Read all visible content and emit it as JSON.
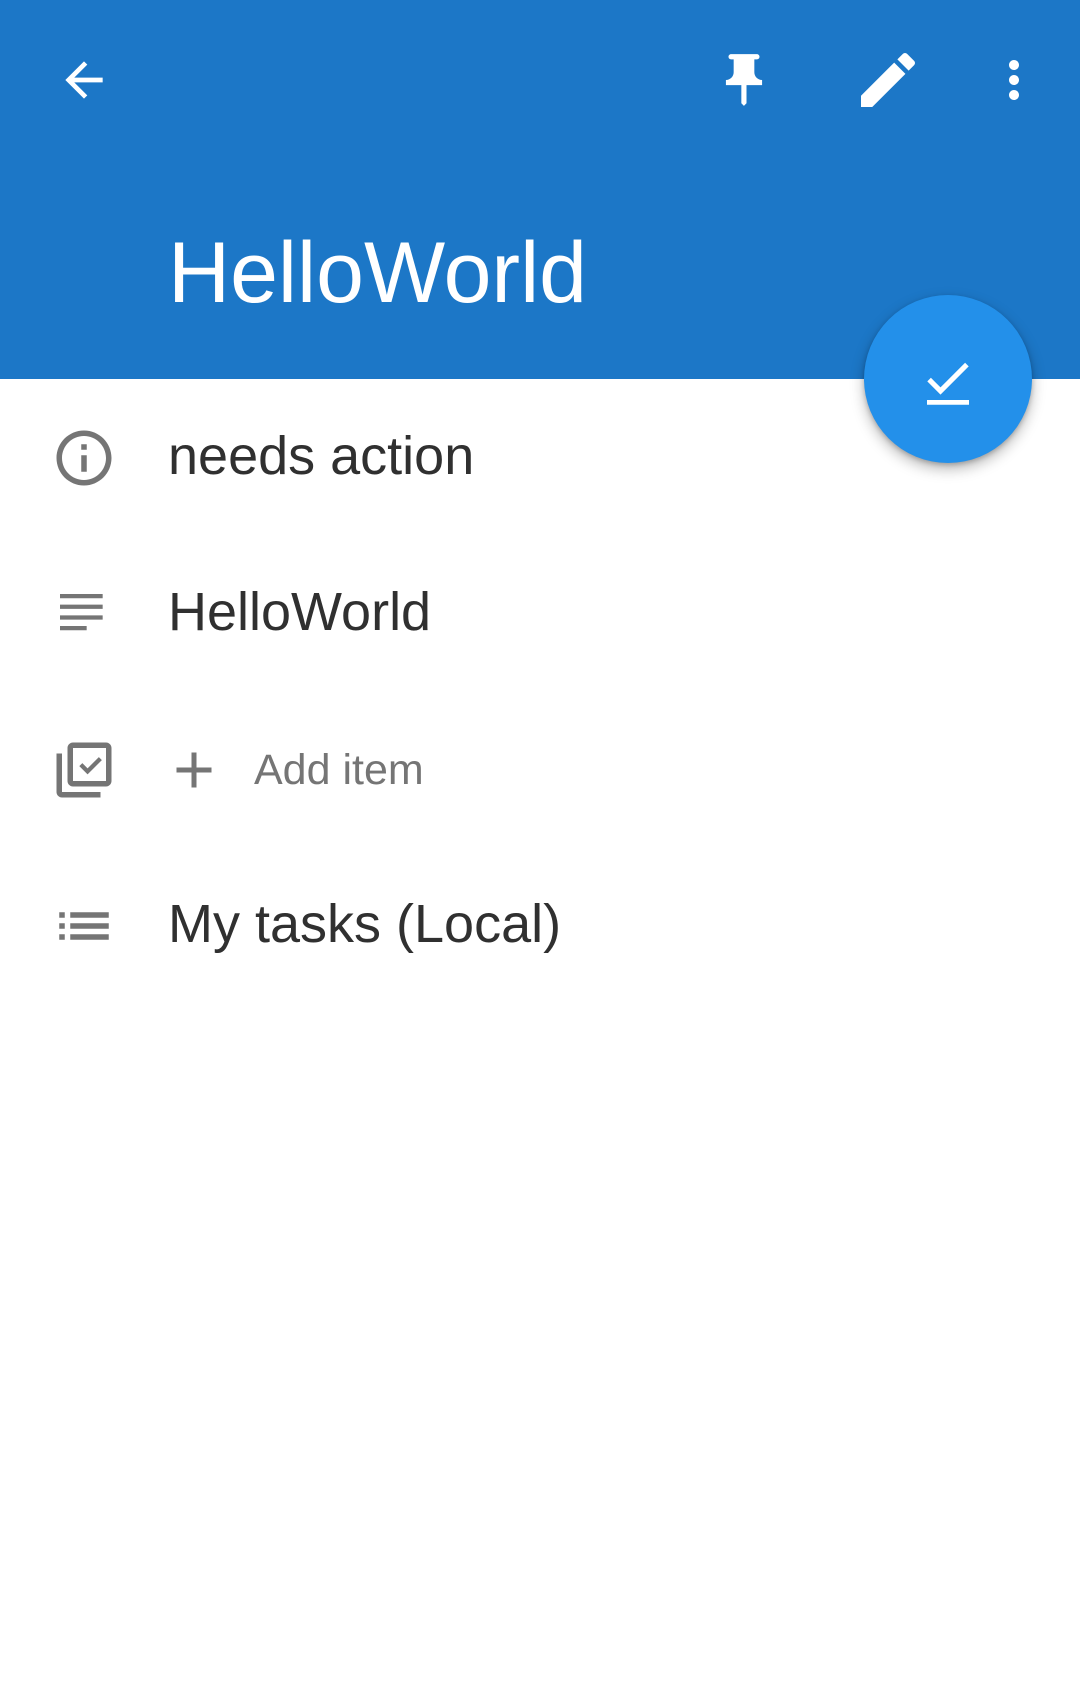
{
  "toolbar": {
    "back_icon": "arrow-back-icon",
    "pin_icon": "pin-icon",
    "edit_icon": "edit-pencil-icon",
    "more_icon": "more-vert-icon"
  },
  "task": {
    "title": "HelloWorld",
    "status": "needs action",
    "description": "HelloWorld",
    "add_item_label": "Add item",
    "list_name": "My tasks (Local)"
  },
  "fab": {
    "icon": "check-done-icon"
  },
  "colors": {
    "header": "#1c77c7",
    "fab": "#2390ea",
    "icon_gray": "#757575",
    "text_dark": "#303030"
  }
}
